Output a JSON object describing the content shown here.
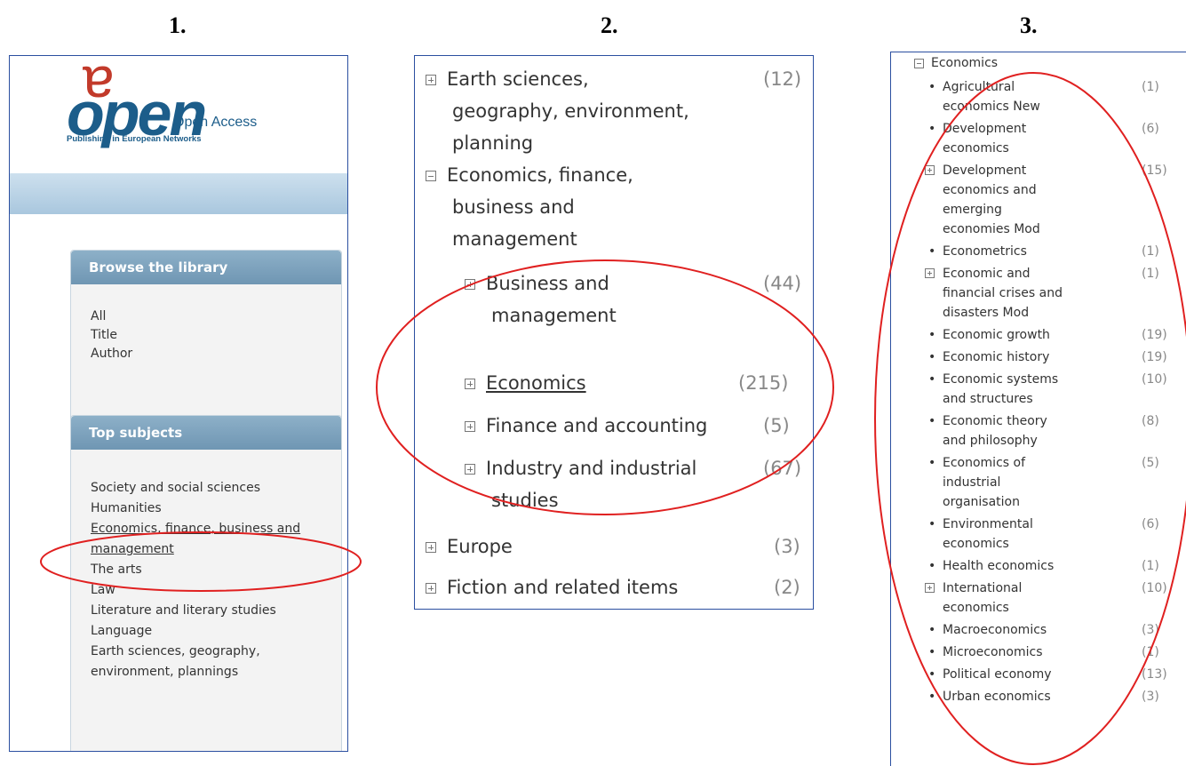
{
  "steps": [
    "1.",
    "2.",
    "3."
  ],
  "panel1": {
    "logo": {
      "word": "open",
      "letter": "a",
      "line1": "Open Access",
      "line2": "Publishing in European Networks"
    },
    "browse": {
      "heading": "Browse the library",
      "items": [
        "All",
        "Title",
        "Author"
      ]
    },
    "subjects": {
      "heading": "Top subjects",
      "items": [
        "Society and social sciences",
        "Humanities",
        "Economics, finance, business and management",
        "The arts",
        "Law",
        "Literature and literary studies",
        "Language",
        "Earth sciences, geography, environment, plannings"
      ]
    }
  },
  "panel2": {
    "earth": {
      "label1": "Earth sciences,",
      "label2": "geography, environment,",
      "label3": "planning",
      "count": "(12)"
    },
    "econ": {
      "label1": "Economics, finance,",
      "label2": "business and",
      "label3": "management"
    },
    "business": {
      "label1": "Business and",
      "label2": "management",
      "count": "(44)"
    },
    "economics": {
      "label": "Economics",
      "count": "(215)"
    },
    "finance": {
      "label": "Finance and accounting",
      "count": "(5)"
    },
    "industry": {
      "label1": "Industry and industrial",
      "label2": "studies",
      "count": "(67)"
    },
    "europe": {
      "label": "Europe",
      "count": "(3)"
    },
    "fiction": {
      "label": "Fiction and related items",
      "count": "(2)"
    }
  },
  "panel3": {
    "heading": "Economics",
    "items": [
      {
        "lines": [
          "Agricultural",
          "economics New"
        ],
        "count": "(1)",
        "marker": "bullet"
      },
      {
        "lines": [
          "Development",
          "economics"
        ],
        "count": "(6)",
        "marker": "bullet"
      },
      {
        "lines": [
          "Development",
          "economics and",
          "emerging",
          "economies Mod"
        ],
        "count": "(15)",
        "marker": "plus"
      },
      {
        "lines": [
          "Econometrics"
        ],
        "count": "(1)",
        "marker": "bullet"
      },
      {
        "lines": [
          "Economic and",
          "financial crises and",
          "disasters Mod"
        ],
        "count": "(1)",
        "marker": "plus"
      },
      {
        "lines": [
          "Economic growth"
        ],
        "count": "(19)",
        "marker": "bullet"
      },
      {
        "lines": [
          "Economic history"
        ],
        "count": "(19)",
        "marker": "bullet"
      },
      {
        "lines": [
          "Economic systems",
          "and structures"
        ],
        "count": "(10)",
        "marker": "bullet"
      },
      {
        "lines": [
          "Economic theory",
          "and philosophy"
        ],
        "count": "(8)",
        "marker": "bullet"
      },
      {
        "lines": [
          "Economics of",
          "industrial",
          "organisation"
        ],
        "count": "(5)",
        "marker": "bullet"
      },
      {
        "lines": [
          "Environmental",
          "economics"
        ],
        "count": "(6)",
        "marker": "bullet"
      },
      {
        "lines": [
          "Health economics"
        ],
        "count": "(1)",
        "marker": "bullet"
      },
      {
        "lines": [
          "International",
          "economics"
        ],
        "count": "(10)",
        "marker": "plus"
      },
      {
        "lines": [
          "Macroeconomics"
        ],
        "count": "(3)",
        "marker": "bullet"
      },
      {
        "lines": [
          "Microeconomics"
        ],
        "count": "(1)",
        "marker": "bullet"
      },
      {
        "lines": [
          "Political economy"
        ],
        "count": "(13)",
        "marker": "bullet"
      },
      {
        "lines": [
          "Urban economics"
        ],
        "count": "(3)",
        "marker": "bullet"
      }
    ]
  },
  "colors": {
    "highlight": "#e02020",
    "frame": "#2b4fa0",
    "box_header": "#7fa3bd"
  }
}
